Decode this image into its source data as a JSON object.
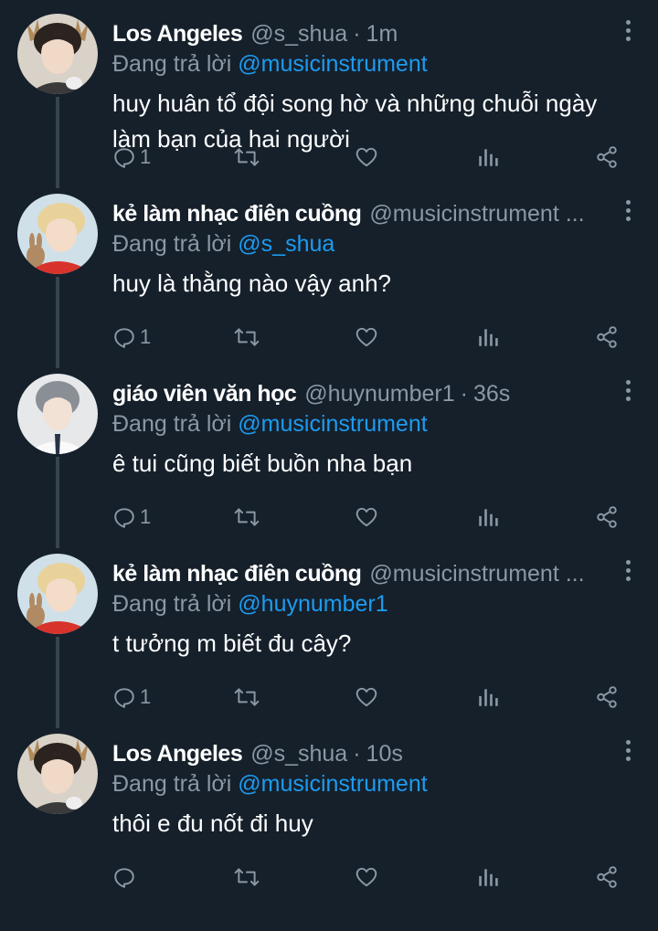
{
  "tweets": [
    {
      "name": "Los Angeles",
      "handle": "@s_shua",
      "time": "1m",
      "replying_prefix": "Đang trả lời",
      "replying_to": "@musicinstrument",
      "text": "huy huân tổ đội song hờ và những chuỗi ngày làm bạn của hai người",
      "reply_count": "1",
      "avatar": "deer-horn-portrait"
    },
    {
      "name": "kẻ làm nhạc điên cuồng",
      "handle": "@musicinstrument ...",
      "time": "",
      "replying_prefix": "Đang trả lời",
      "replying_to": "@s_shua",
      "text": "huy là thằng nào vậy anh?",
      "reply_count": "1",
      "avatar": "blonde-red-sweater-portrait"
    },
    {
      "name": "giáo viên văn học",
      "handle": "@huynumber1",
      "time": "36s",
      "replying_prefix": "Đang trả lời",
      "replying_to": "@musicinstrument",
      "text": "ê tui cũng biết buồn nha bạn",
      "reply_count": "1",
      "avatar": "white-shirt-portrait"
    },
    {
      "name": "kẻ làm nhạc điên cuồng",
      "handle": "@musicinstrument ...",
      "time": "",
      "replying_prefix": "Đang trả lời",
      "replying_to": "@huynumber1",
      "text": "t tưởng m biết đu cây?",
      "reply_count": "1",
      "avatar": "blonde-red-sweater-portrait"
    },
    {
      "name": "Los Angeles",
      "handle": "@s_shua",
      "time": "10s",
      "replying_prefix": "Đang trả lời",
      "replying_to": "@musicinstrument",
      "text": "thôi e đu nốt đi huy",
      "reply_count": "",
      "avatar": "deer-horn-portrait"
    }
  ],
  "icons": {
    "reply": "reply-icon",
    "retweet": "retweet-icon",
    "like": "heart-icon",
    "analytics": "analytics-icon",
    "share": "share-icon",
    "more": "more-vertical-icon"
  },
  "colors": {
    "background": "#15202b",
    "text": "#ffffff",
    "muted": "#8b98a5",
    "link": "#1d9bf0",
    "thread_line": "#38444d"
  }
}
